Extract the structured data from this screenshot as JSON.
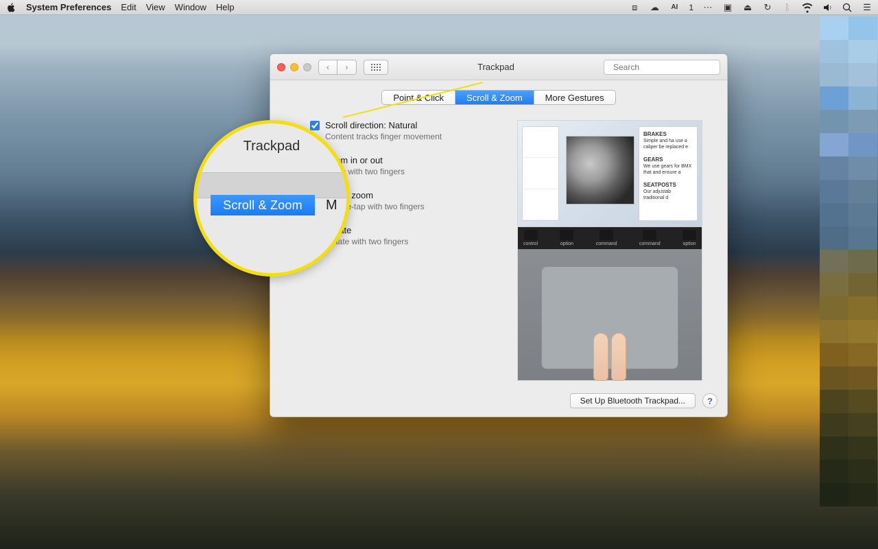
{
  "menubar": {
    "app_name": "System Preferences",
    "items": [
      "Edit",
      "View",
      "Window",
      "Help"
    ],
    "status_text": "1"
  },
  "window": {
    "title": "Trackpad",
    "search_placeholder": "Search",
    "tabs": [
      {
        "label": "Point & Click"
      },
      {
        "label": "Scroll & Zoom",
        "active": true
      },
      {
        "label": "More Gestures"
      }
    ],
    "options": [
      {
        "title": "Scroll direction: Natural",
        "sub": "Content tracks finger movement",
        "checked": true
      },
      {
        "title": "Zoom in or out",
        "sub": "Pinch with two fingers",
        "checked": true
      },
      {
        "title": "Smart zoom",
        "sub": "Double-tap with two fingers",
        "checked": true,
        "current": true
      },
      {
        "title": "Rotate",
        "sub": "Rotate with two fingers",
        "checked": true
      }
    ],
    "preview": {
      "right_panel": {
        "heading_a": "BRAKES",
        "body_a": "Simple and ha use a caliper be replaced e",
        "heading_b": "GEARS",
        "body_b": "We use gears for BMX that and ensure a",
        "heading_c": "SEATPOSTS",
        "body_c": "Our adjustab traditional d"
      },
      "keys": [
        "control",
        "option",
        "command",
        "command",
        "option"
      ]
    },
    "footer": {
      "bluetooth": "Set Up Bluetooth Trackpad...",
      "help": "?"
    }
  },
  "callout": {
    "title": "Trackpad",
    "tab": "Scroll & Zoom",
    "next": "M"
  }
}
